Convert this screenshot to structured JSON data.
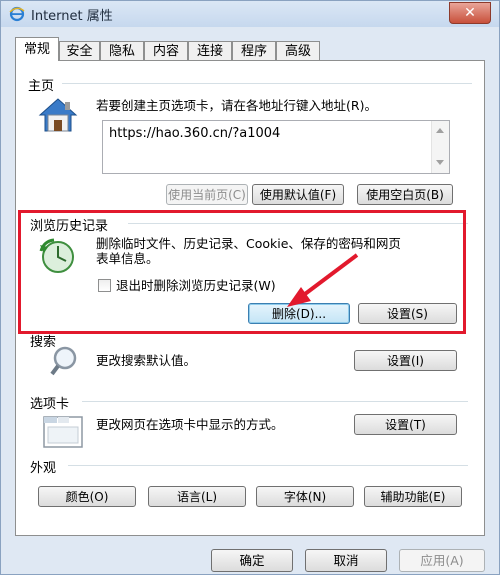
{
  "window": {
    "title": "Internet 属性",
    "close_label": "✕"
  },
  "tabs": [
    {
      "label": "常规",
      "active": true
    },
    {
      "label": "安全"
    },
    {
      "label": "隐私"
    },
    {
      "label": "内容"
    },
    {
      "label": "连接"
    },
    {
      "label": "程序"
    },
    {
      "label": "高级"
    }
  ],
  "home": {
    "title": "主页",
    "description": "若要创建主页选项卡，请在各地址行键入地址(R)。",
    "url": "https://hao.360.cn/?a1004",
    "buttons": {
      "use_current": "使用当前页(C)",
      "use_default": "使用默认值(F)",
      "use_blank": "使用空白页(B)"
    }
  },
  "history": {
    "title": "浏览历史记录",
    "description_line1": "删除临时文件、历史记录、Cookie、保存的密码和网页",
    "description_line2": "表单信息。",
    "checkbox_label": "退出时删除浏览历史记录(W)",
    "checkbox_checked": false,
    "delete_button": "删除(D)...",
    "settings_button": "设置(S)"
  },
  "search": {
    "title": "搜索",
    "description": "更改搜索默认值。",
    "settings_button": "设置(I)"
  },
  "tabs_section": {
    "title": "选项卡",
    "description": "更改网页在选项卡中显示的方式。",
    "settings_button": "设置(T)"
  },
  "appearance": {
    "title": "外观",
    "buttons": {
      "colors": "颜色(O)",
      "languages": "语言(L)",
      "fonts": "字体(N)",
      "accessibility": "辅助功能(E)"
    }
  },
  "footer": {
    "ok": "确定",
    "cancel": "取消",
    "apply": "应用(A)"
  },
  "colors": {
    "annotation_red": "#e2192d"
  }
}
